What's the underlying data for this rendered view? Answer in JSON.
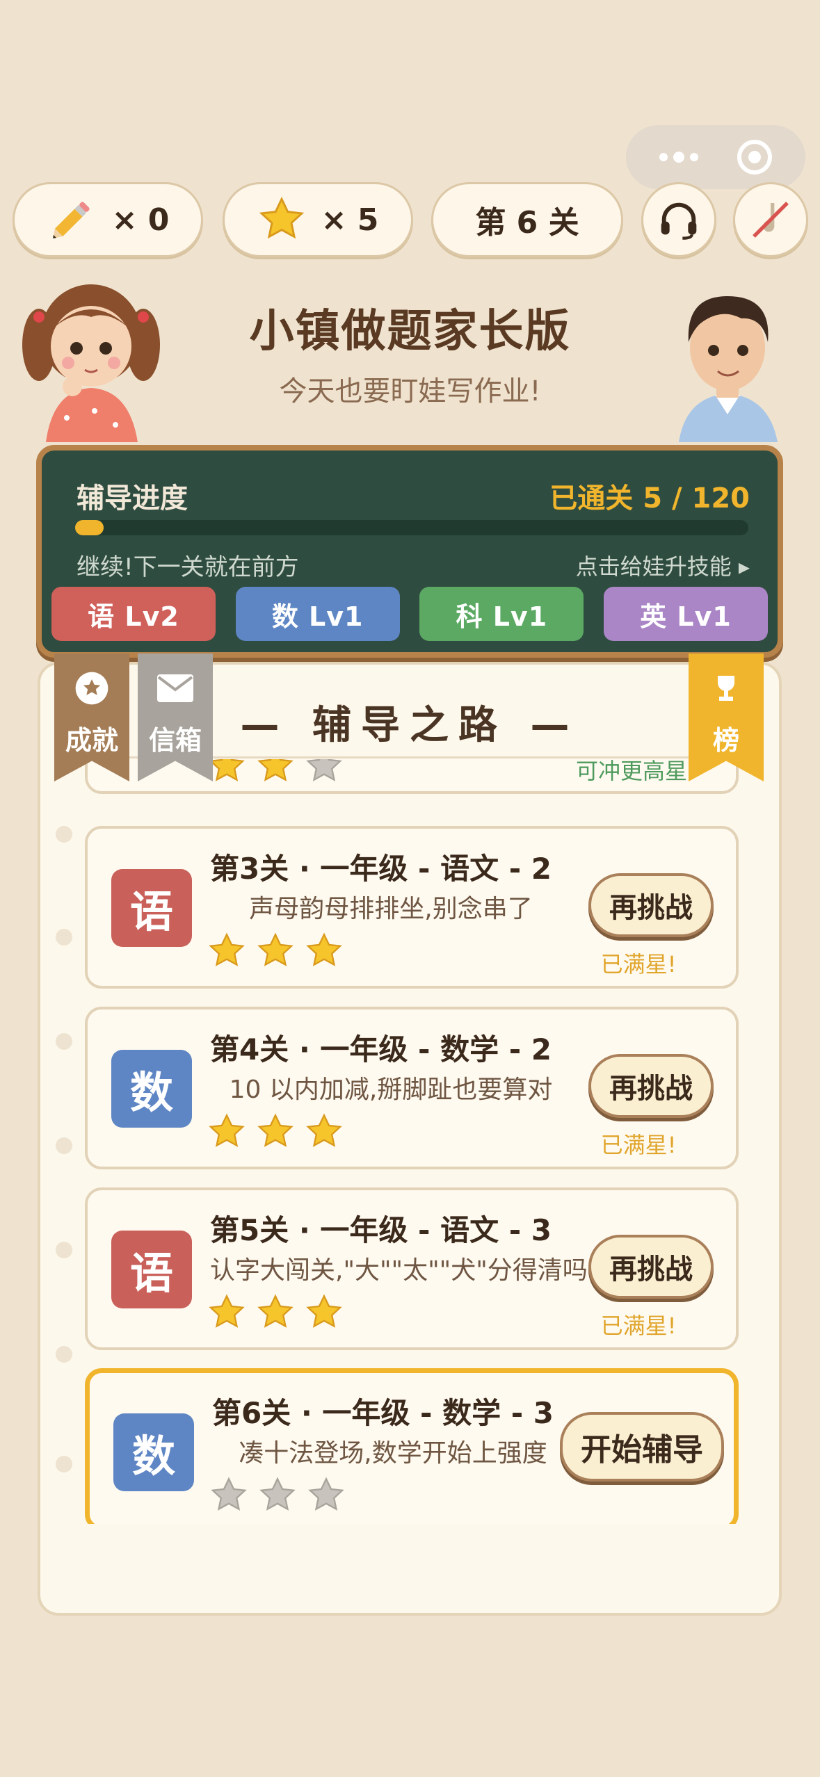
{
  "topbar": {
    "pencil_count": "× 0",
    "star_count": "× 5",
    "level": "第 6 关"
  },
  "header": {
    "title": "小镇做题家长版",
    "subtitle": "今天也要盯娃写作业!"
  },
  "progress": {
    "label": "辅导进度",
    "cleared_text": "已通关 5 / 120",
    "fraction": 0.042,
    "hint": "继续!下一关就在前方",
    "skill_link": "点击给娃升技能 ▸",
    "subjects": [
      {
        "label": "语 Lv2",
        "color": "#d0605a"
      },
      {
        "label": "数 Lv1",
        "color": "#5f86c4"
      },
      {
        "label": "科 Lv1",
        "color": "#5ba963"
      },
      {
        "label": "英 Lv1",
        "color": "#ab86c6"
      }
    ]
  },
  "ribbons": {
    "achievements": "成就",
    "mailbox": "信箱",
    "leaderboard": "榜"
  },
  "road": {
    "title": "— 辅导之路 —",
    "partial_status": "可冲更高星",
    "levels": [
      {
        "badge": "语",
        "badge_color": "#c9605a",
        "title": "第3关 · 一年级 - 语文 - 2",
        "desc": "声母韵母排排坐,别念串了",
        "stars": 3,
        "button": "再挑战",
        "status": "已满星!"
      },
      {
        "badge": "数",
        "badge_color": "#5f86c4",
        "title": "第4关 · 一年级 - 数学 - 2",
        "desc": "10 以内加减,掰脚趾也要算对",
        "stars": 3,
        "button": "再挑战",
        "status": "已满星!"
      },
      {
        "badge": "语",
        "badge_color": "#c9605a",
        "title": "第5关 · 一年级 - 语文 - 3",
        "desc": "认字大闯关,\"大\"\"太\"\"犬\"分得清吗",
        "stars": 3,
        "button": "再挑战",
        "status": "已满星!"
      },
      {
        "badge": "数",
        "badge_color": "#5f86c4",
        "title": "第6关 · 一年级 - 数学 - 3",
        "desc": "凑十法登场,数学开始上强度",
        "stars": 0,
        "button": "开始辅导",
        "status": ""
      }
    ]
  }
}
